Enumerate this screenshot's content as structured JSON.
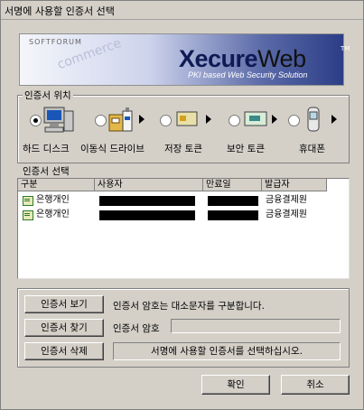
{
  "window": {
    "title": "서명에 사용할 인증서 선택"
  },
  "banner": {
    "brand": "SOFTFORUM",
    "watermark": "commerce",
    "logo_bold": "Xecure",
    "logo_light": "Web",
    "trademark": "TM",
    "tagline": "PKI based Web Security Solution"
  },
  "location": {
    "label": "인증서 위치",
    "devices": [
      {
        "label": "하드 디스크",
        "icon": "computer-icon",
        "selected": true
      },
      {
        "label": "이동식 드라이브",
        "icon": "removable-drive-icon",
        "selected": false
      },
      {
        "label": "저장 토큰",
        "icon": "storage-token-icon",
        "selected": false
      },
      {
        "label": "보안 토큰",
        "icon": "security-token-icon",
        "selected": false
      },
      {
        "label": "휴대폰",
        "icon": "mobile-phone-icon",
        "selected": false
      }
    ]
  },
  "cert_list": {
    "label": "인증서 선택",
    "columns": [
      "구분",
      "사용자",
      "만료일",
      "발급자"
    ],
    "rows": [
      {
        "type": "은행개인",
        "issuer": "금융결제원"
      },
      {
        "type": "은행개인",
        "issuer": "금융결제원"
      }
    ]
  },
  "actions": {
    "view_label": "인증서 보기",
    "find_label": "인증서 찾기",
    "delete_label": "인증서 삭제",
    "case_notice": "인증서 암호는 대소문자를 구분합니다.",
    "password_label": "인증서 암호",
    "password_value": "",
    "status_text": "서명에 사용할 인증서를 선택하십시오."
  },
  "dialog": {
    "ok_label": "확인",
    "cancel_label": "취소"
  },
  "colors": {
    "face": "#d4d0c8",
    "banner_dark": "#2c3d86"
  }
}
